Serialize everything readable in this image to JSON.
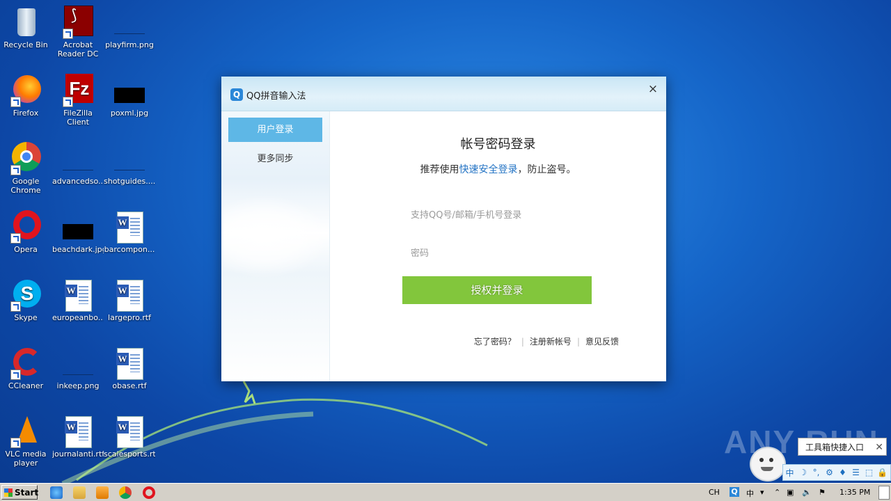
{
  "desktop": {
    "icons": [
      {
        "label": "Recycle Bin"
      },
      {
        "label": "Acrobat\nReader DC"
      },
      {
        "label": "playfirm.png"
      },
      {
        "label": "Firefox"
      },
      {
        "label": "FileZilla Client"
      },
      {
        "label": "poxml.jpg"
      },
      {
        "label": "Google\nChrome"
      },
      {
        "label": "advancedso..."
      },
      {
        "label": "shotguides...."
      },
      {
        "label": "Opera"
      },
      {
        "label": "beachdark.jpg"
      },
      {
        "label": "barcompon..."
      },
      {
        "label": "Skype"
      },
      {
        "label": "europeanbo..."
      },
      {
        "label": "largepro.rtf"
      },
      {
        "label": "CCleaner"
      },
      {
        "label": "inkeep.png"
      },
      {
        "label": "obase.rtf"
      },
      {
        "label": "VLC media\nplayer"
      },
      {
        "label": "journalanti.rtf"
      },
      {
        "label": "scalesports.rtf"
      }
    ]
  },
  "dialog": {
    "logo": "Q",
    "title": "QQ拼音输入法",
    "close": "×",
    "sidebar": [
      {
        "label": "用户登录"
      },
      {
        "label": "更多同步"
      }
    ],
    "heading": "帐号密码登录",
    "subtitle_pre": "推荐使用",
    "subtitle_link": "快速安全登录",
    "subtitle_post": "，防止盗号。",
    "account_placeholder": "支持QQ号/邮箱/手机号登录",
    "password_placeholder": "密码",
    "login_button": "授权并登录",
    "links": {
      "forgot": "忘了密码？",
      "register": "注册新帐号",
      "feedback": "意见反馈"
    }
  },
  "watermark": "ANY RUN",
  "tooltip": {
    "text": "工具箱快捷入口",
    "close": "✕"
  },
  "ime_bar": [
    "中",
    "☽",
    "°,",
    "⚙",
    "♦",
    "☰",
    "⬚",
    "🔒"
  ],
  "taskbar": {
    "start_label": "Start",
    "tray": {
      "lang": "CH",
      "qq": "Q",
      "ime": "中",
      "arrow": "▾",
      "up": "⌃",
      "net": "▣",
      "vol": "🔈",
      "flag": "⚑"
    },
    "clock": "1:35 PM"
  },
  "colors": {
    "login_button": "#82c63c",
    "sidebar_active": "#5eb7e6",
    "link": "#2373c4"
  }
}
